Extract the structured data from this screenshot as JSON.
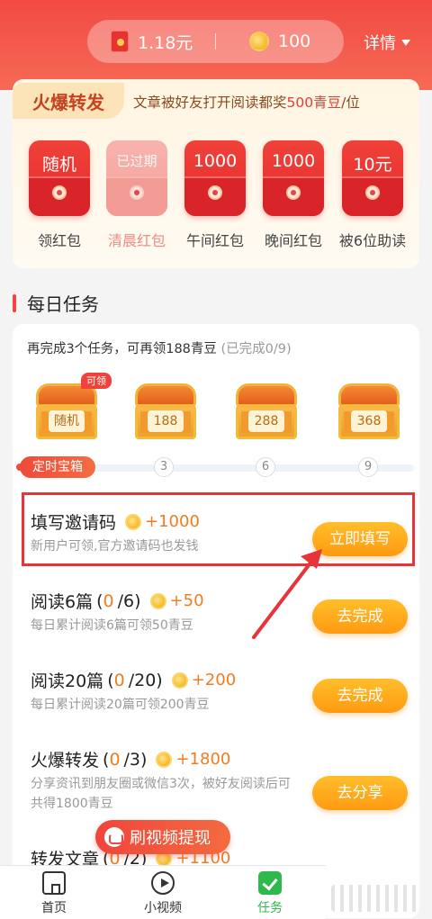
{
  "header": {
    "cash": "1.18元",
    "beans": "100",
    "detail_label": "详情"
  },
  "share": {
    "tag": "火爆转发",
    "desc_prefix": "文章被好友打开阅读都奖",
    "desc_highlight": "500青豆",
    "desc_suffix": "/位",
    "packets": [
      {
        "top": "随机",
        "label": "领红包",
        "state": "active"
      },
      {
        "top": "已过期",
        "label": "清晨红包",
        "state": "expired"
      },
      {
        "top": "1000",
        "label": "午间红包",
        "state": "active"
      },
      {
        "top": "1000",
        "label": "晚间红包",
        "state": "active"
      },
      {
        "top": "10元",
        "label": "被6位助读",
        "state": "active"
      }
    ]
  },
  "daily": {
    "title": "每日任务",
    "intro_main": "再完成3个任务，可再领188青豆",
    "intro_sub": "(已完成0/9)",
    "chests": [
      {
        "plate": "随机",
        "badge": "可领"
      },
      {
        "plate": "188",
        "badge": ""
      },
      {
        "plate": "288",
        "badge": ""
      },
      {
        "plate": "368",
        "badge": ""
      }
    ],
    "progress_start": "定时宝箱",
    "progress_nodes": [
      "3",
      "6",
      "9"
    ]
  },
  "tasks": [
    {
      "title": "填写邀请码",
      "prog_done": "",
      "prog_total": "",
      "reward": "+1000",
      "desc": "新用户可领,官方邀请码也发钱",
      "button": "立即填写"
    },
    {
      "title": "阅读6篇",
      "prog_done": "0",
      "prog_total": "/6",
      "reward": "+50",
      "desc": "每日累计阅读6篇可领50青豆",
      "button": "去完成"
    },
    {
      "title": "阅读20篇",
      "prog_done": "0",
      "prog_total": "/20",
      "reward": "+200",
      "desc": "每日累计阅读20篇可领200青豆",
      "button": "去完成"
    },
    {
      "title": "火爆转发",
      "prog_done": "0",
      "prog_total": "/3",
      "reward": "+1800",
      "desc": "分享资讯到朋友圈或微信3次，被好友阅读后可共得1800青豆",
      "button": "去分享"
    },
    {
      "title": "转发文章",
      "prog_done": "0",
      "prog_total": "/2",
      "reward": "+1100",
      "desc": "",
      "button": ""
    }
  ],
  "float_button": "刷视频提现",
  "tabbar": [
    {
      "label": "首页",
      "icon": "home-icon"
    },
    {
      "label": "小视频",
      "icon": "video-icon"
    },
    {
      "label": "任务",
      "icon": "task-check-icon"
    }
  ],
  "colors": {
    "brand_red": "#f24a43",
    "accent_orange": "#ef7d20",
    "button_orange": "#ff9a12",
    "active_tab": "#2fb84b"
  }
}
